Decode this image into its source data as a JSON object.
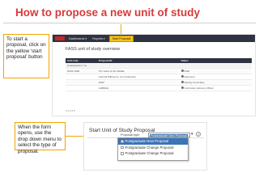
{
  "slide": {
    "title": "How to propose a new unit of study",
    "callout_1": "To start a proposal, click on the yellow ‘start proposal’ button",
    "callout_2": "When the form opens, use the drop down menu to select the type of proposal."
  },
  "screenshot_1": {
    "nav": [
      "Dashboards ▾",
      "Reports ▾"
    ],
    "start_button": "Start Proposal",
    "page_title": "FASS unit of study overview",
    "table_header": [
      "Unit code",
      "Proposal ID",
      "Status"
    ],
    "sub_header": "Unassigned to me",
    "rows": [
      {
        "code": "FASS 1000",
        "name": "The world of the ANGEL",
        "status": "Draft"
      },
      {
        "code": "",
        "name": "Cultural Difference: An Introduction",
        "status": "Approved"
      },
      {
        "code": "",
        "name": "HUM",
        "status": "Faculty Committee"
      },
      {
        "code": "",
        "name": "AHBRAH",
        "status": "Curriculum Advisory Officer"
      }
    ],
    "pagination": "1  2  3  4  5"
  },
  "screenshot_2": {
    "title": "Start Unit of Study Proposal",
    "proposal_label": "Proposal type",
    "selected": "Postgraduate New Proposal",
    "options": [
      "Postgraduate New Proposal",
      "Postgraduate Change Proposal",
      "Postgraduate Change Proposal"
    ]
  },
  "colors": {
    "title": "#d73a3a",
    "callout_border": "#f2a400",
    "start_button": "#f5c217",
    "topbar": "#2f3240",
    "selection": "#3b74b8"
  }
}
